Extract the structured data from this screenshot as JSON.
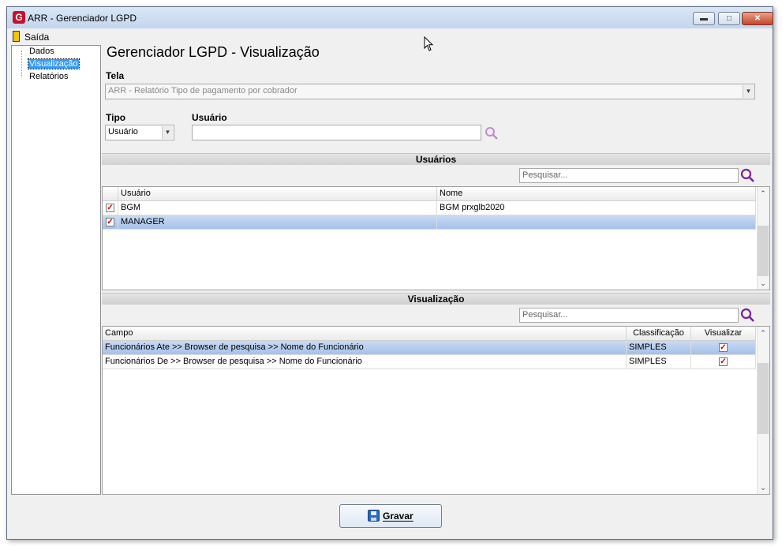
{
  "window": {
    "title": "ARR - Gerenciador LGPD",
    "logo_letter": "G",
    "controls": {
      "minimize": "▬",
      "maximize": "□",
      "close": "✕"
    }
  },
  "menu": {
    "exit_label": "Saída"
  },
  "tree": {
    "items": [
      {
        "label": "Dados",
        "selected": false
      },
      {
        "label": "Visualização",
        "selected": true
      },
      {
        "label": "Relatórios",
        "selected": false
      }
    ]
  },
  "page": {
    "title": "Gerenciador LGPD - Visualização"
  },
  "tela": {
    "label": "Tela",
    "value": "ARR - Relatório Tipo de pagamento por cobrador"
  },
  "tipo": {
    "label": "Tipo",
    "value": "Usuário"
  },
  "usuario": {
    "label": "Usuário",
    "value": ""
  },
  "users_section": {
    "title": "Usuários",
    "search_placeholder": "Pesquisar...",
    "columns": [
      "Usuário",
      "Nome"
    ],
    "rows": [
      {
        "checked": true,
        "user": "BGM",
        "name": "BGM prxglb2020",
        "selected": false
      },
      {
        "checked": true,
        "user": "MANAGER",
        "name": "",
        "selected": true
      }
    ]
  },
  "visual_section": {
    "title": "Visualização",
    "search_placeholder": "Pesquisar...",
    "columns": [
      "Campo",
      "Classificação",
      "Visualizar"
    ],
    "rows": [
      {
        "campo": "Funcionários Ate >> Browser de pesquisa >> Nome do Funcionário",
        "classificacao": "SIMPLES",
        "visualizar": true,
        "selected": true
      },
      {
        "campo": "Funcionários De >> Browser de pesquisa >> Nome do Funcionário",
        "classificacao": "SIMPLES",
        "visualizar": true,
        "selected": false
      }
    ]
  },
  "save_button": {
    "label": "Gravar"
  },
  "glyphs": {
    "check": "✓",
    "dropdown": "▼",
    "scroll_up": "⌃",
    "scroll_down": "⌄"
  },
  "colors": {
    "selection": "#3399ff",
    "row_highlight": "#b7cdef",
    "search_icon": "#7a1fa2",
    "check": "#c40000"
  }
}
